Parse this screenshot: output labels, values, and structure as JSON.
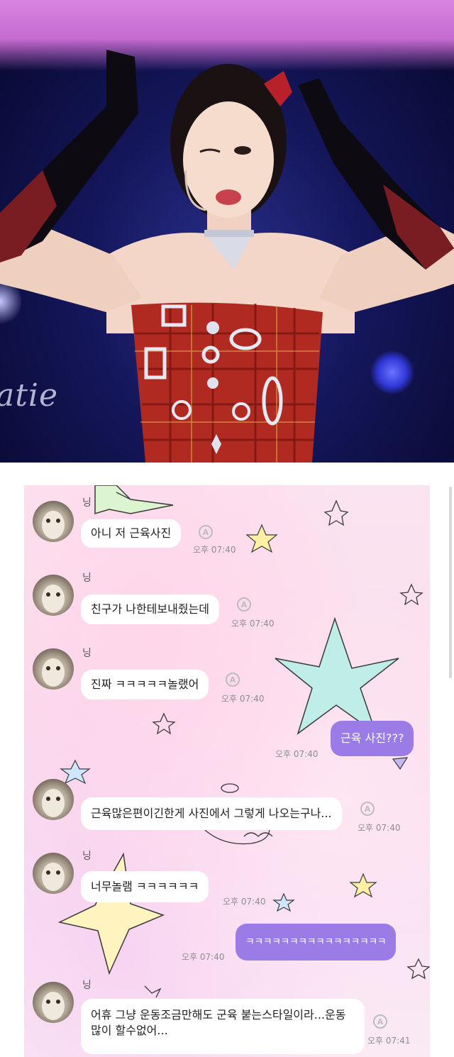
{
  "photo": {
    "watermark": "atie"
  },
  "chat": {
    "messages": [
      {
        "sender": "닝",
        "text": "아니 저 근육사진",
        "unread_icon": "A",
        "time": "오후 07:40"
      },
      {
        "sender": "닝",
        "text": "친구가 나한테보내줬는데",
        "unread_icon": "A",
        "time": "오후 07:40"
      },
      {
        "sender": "닝",
        "text": "진짜 ㅋㅋㅋㅋㅋ놀랬어",
        "unread_icon": "A",
        "time": "오후 07:40"
      },
      {
        "sender": "me",
        "text": "근육 사진???",
        "time": "오후 07:40"
      },
      {
        "sender": "",
        "text": "근육많은편이긴한게 사진에서 그렇게 나오는구나...",
        "unread_icon": "A",
        "time": "오후 07:40"
      },
      {
        "sender": "닝",
        "text": "너무놀램 ㅋㅋㅋㅋㅋㅋ",
        "time": "오후 07:40"
      },
      {
        "sender": "me",
        "text": "ㅋㅋㅋㅋㅋㅋㅋㅋㅋㅋㅋㅋㅋㅋㅋㅋ",
        "time": "오후 07:40"
      },
      {
        "sender": "닝",
        "text": "어휴 그냥 운동조금만해도 군육 붙는스타일이라...운동 많이 할수없어...",
        "unread_icon": "A",
        "time": "오후 07:41"
      }
    ]
  },
  "colors": {
    "my_bubble": "#9b7ce6",
    "their_bubble": "#ffffff",
    "chat_background": "#fbe4f1"
  }
}
